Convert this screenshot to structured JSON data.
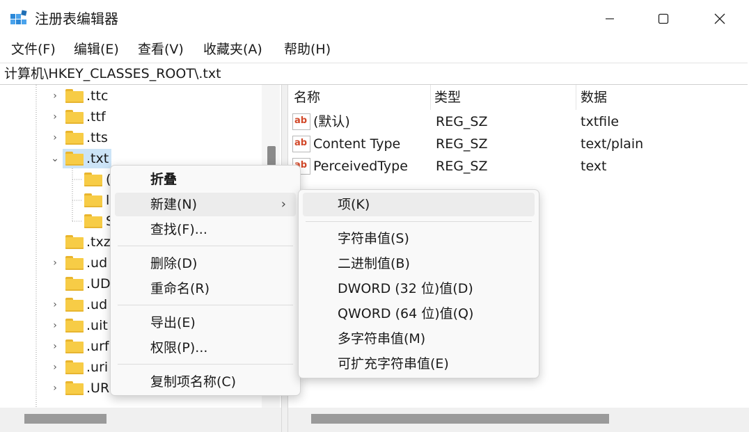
{
  "window": {
    "title": "注册表编辑器",
    "minimize": "—",
    "maximize": "☐",
    "close": "✕"
  },
  "menubar": [
    "文件(F)",
    "编辑(E)",
    "查看(V)",
    "收藏夹(A)",
    "帮助(H)"
  ],
  "address": "计算机\\HKEY_CLASSES_ROOT\\.txt",
  "tree": {
    "items": [
      {
        "label": ".ttc",
        "expander": "›"
      },
      {
        "label": ".ttf",
        "expander": "›"
      },
      {
        "label": ".tts",
        "expander": "›"
      },
      {
        "label": ".txt",
        "expander": "⌄",
        "selected": true
      },
      {
        "label": "(",
        "expander": ""
      },
      {
        "label": "l",
        "expander": ""
      },
      {
        "label": "S",
        "expander": ""
      },
      {
        "label": ".txz",
        "expander": ""
      },
      {
        "label": ".ud",
        "expander": "›"
      },
      {
        "label": ".UD",
        "expander": ""
      },
      {
        "label": ".ud",
        "expander": "›"
      },
      {
        "label": ".uit",
        "expander": "›"
      },
      {
        "label": ".urf",
        "expander": "›"
      },
      {
        "label": ".uri",
        "expander": "›"
      },
      {
        "label": ".UR",
        "expander": "›"
      }
    ]
  },
  "list": {
    "headers": [
      "名称",
      "类型",
      "数据"
    ],
    "rows": [
      {
        "name": "(默认)",
        "type": "REG_SZ",
        "data": "txtfile"
      },
      {
        "name": "Content Type",
        "type": "REG_SZ",
        "data": "text/plain"
      },
      {
        "name": "PerceivedType",
        "type": "REG_SZ",
        "data": "text"
      }
    ],
    "icon_text": "ab"
  },
  "context_menu": {
    "items": [
      "折叠",
      "新建(N)",
      "查找(F)...",
      "删除(D)",
      "重命名(R)",
      "导出(E)",
      "权限(P)...",
      "复制项名称(C)"
    ],
    "submenu_arrow": "›"
  },
  "submenu": {
    "items": [
      "项(K)",
      "字符串值(S)",
      "二进制值(B)",
      "DWORD (32 位)值(D)",
      "QWORD (64 位)值(Q)",
      "多字符串值(M)",
      "可扩充字符串值(E)"
    ]
  },
  "colors": {
    "folder": "#f7cc46",
    "selection": "#cce4f7",
    "ab_icon": "#d2492a"
  }
}
